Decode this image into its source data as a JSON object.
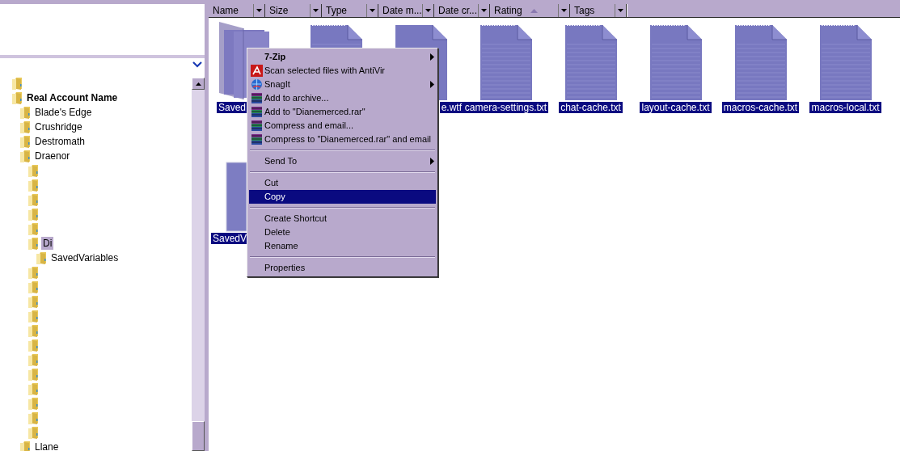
{
  "tree": {
    "items": [
      {
        "selected": false
      },
      {
        "label": "Real Account Name",
        "bold": true,
        "selected": false,
        "children": [
          {
            "label": "Blade's Edge",
            "selected": false
          },
          {
            "label": "Crushridge",
            "selected": false
          },
          {
            "label": "Destromath",
            "selected": false
          },
          {
            "label": "Draenor",
            "selected": false,
            "children": [
              {
                "selected": false
              },
              {
                "selected": false
              },
              {
                "selected": false
              },
              {
                "selected": false
              },
              {
                "selected": false
              },
              {
                "label": "Di",
                "selected": true,
                "children": [
                  {
                    "label": "SavedVariables",
                    "selected": false
                  }
                ]
              },
              {
                "selected": false
              },
              {
                "selected": false
              },
              {
                "selected": false
              },
              {
                "selected": false
              },
              {
                "selected": false
              },
              {
                "selected": false
              },
              {
                "selected": false
              },
              {
                "selected": false
              },
              {
                "selected": false
              },
              {
                "selected": false
              },
              {
                "selected": false
              },
              {
                "selected": false
              }
            ]
          },
          {
            "label": "Llane",
            "selected": false
          }
        ]
      }
    ]
  },
  "columns": [
    {
      "label": "Name",
      "sorted": false
    },
    {
      "label": "Size",
      "sorted": false
    },
    {
      "label": "Type",
      "sorted": false
    },
    {
      "label": "Date m...",
      "sorted": false
    },
    {
      "label": "Date cr...",
      "sorted": false
    },
    {
      "label": "Rating",
      "sorted": true
    },
    {
      "label": "Tags",
      "sorted": false
    }
  ],
  "files": [
    {
      "kind": "folder",
      "label": "Saved",
      "selected": true
    },
    {
      "kind": "text",
      "selected": true
    },
    {
      "kind": "document",
      "label": "e.wtf",
      "selected": true
    },
    {
      "kind": "text",
      "label": "camera-settings.txt",
      "selected": true
    },
    {
      "kind": "text",
      "label": "chat-cache.txt",
      "selected": true
    },
    {
      "kind": "text",
      "label": "layout-cache.txt",
      "selected": true
    },
    {
      "kind": "text",
      "label": "macros-cache.txt",
      "selected": true
    },
    {
      "kind": "text",
      "label": "macros-local.txt",
      "selected": true
    },
    {
      "kind": "block",
      "label": "SavedV",
      "selected": true
    }
  ],
  "context_menu": {
    "items": [
      {
        "kind": "item",
        "label": "7-Zip",
        "bold": true,
        "submenu": true,
        "selected": false
      },
      {
        "kind": "antivirus",
        "label": "Scan selected files with AntiVir",
        "selected": false
      },
      {
        "kind": "capture",
        "label": "SnagIt",
        "submenu": true,
        "selected": false
      },
      {
        "kind": "archive",
        "label": "Add to archive...",
        "selected": false
      },
      {
        "kind": "archive",
        "label": "Add to \"Dianemerced.rar\"",
        "selected": false
      },
      {
        "kind": "archive",
        "label": "Compress and email...",
        "selected": false
      },
      {
        "kind": "archive",
        "label": "Compress to \"Dianemerced.rar\" and email",
        "selected": false
      },
      {
        "kind": "separator"
      },
      {
        "kind": "item",
        "label": "Send To",
        "submenu": true,
        "selected": false
      },
      {
        "kind": "separator"
      },
      {
        "kind": "item",
        "label": "Cut",
        "selected": false
      },
      {
        "kind": "item",
        "label": "Copy",
        "selected": true
      },
      {
        "kind": "separator"
      },
      {
        "kind": "item",
        "label": "Create Shortcut",
        "selected": false
      },
      {
        "kind": "item",
        "label": "Delete",
        "selected": false
      },
      {
        "kind": "item",
        "label": "Rename",
        "selected": false
      },
      {
        "kind": "separator"
      },
      {
        "kind": "item",
        "label": "Properties",
        "selected": false
      }
    ]
  }
}
